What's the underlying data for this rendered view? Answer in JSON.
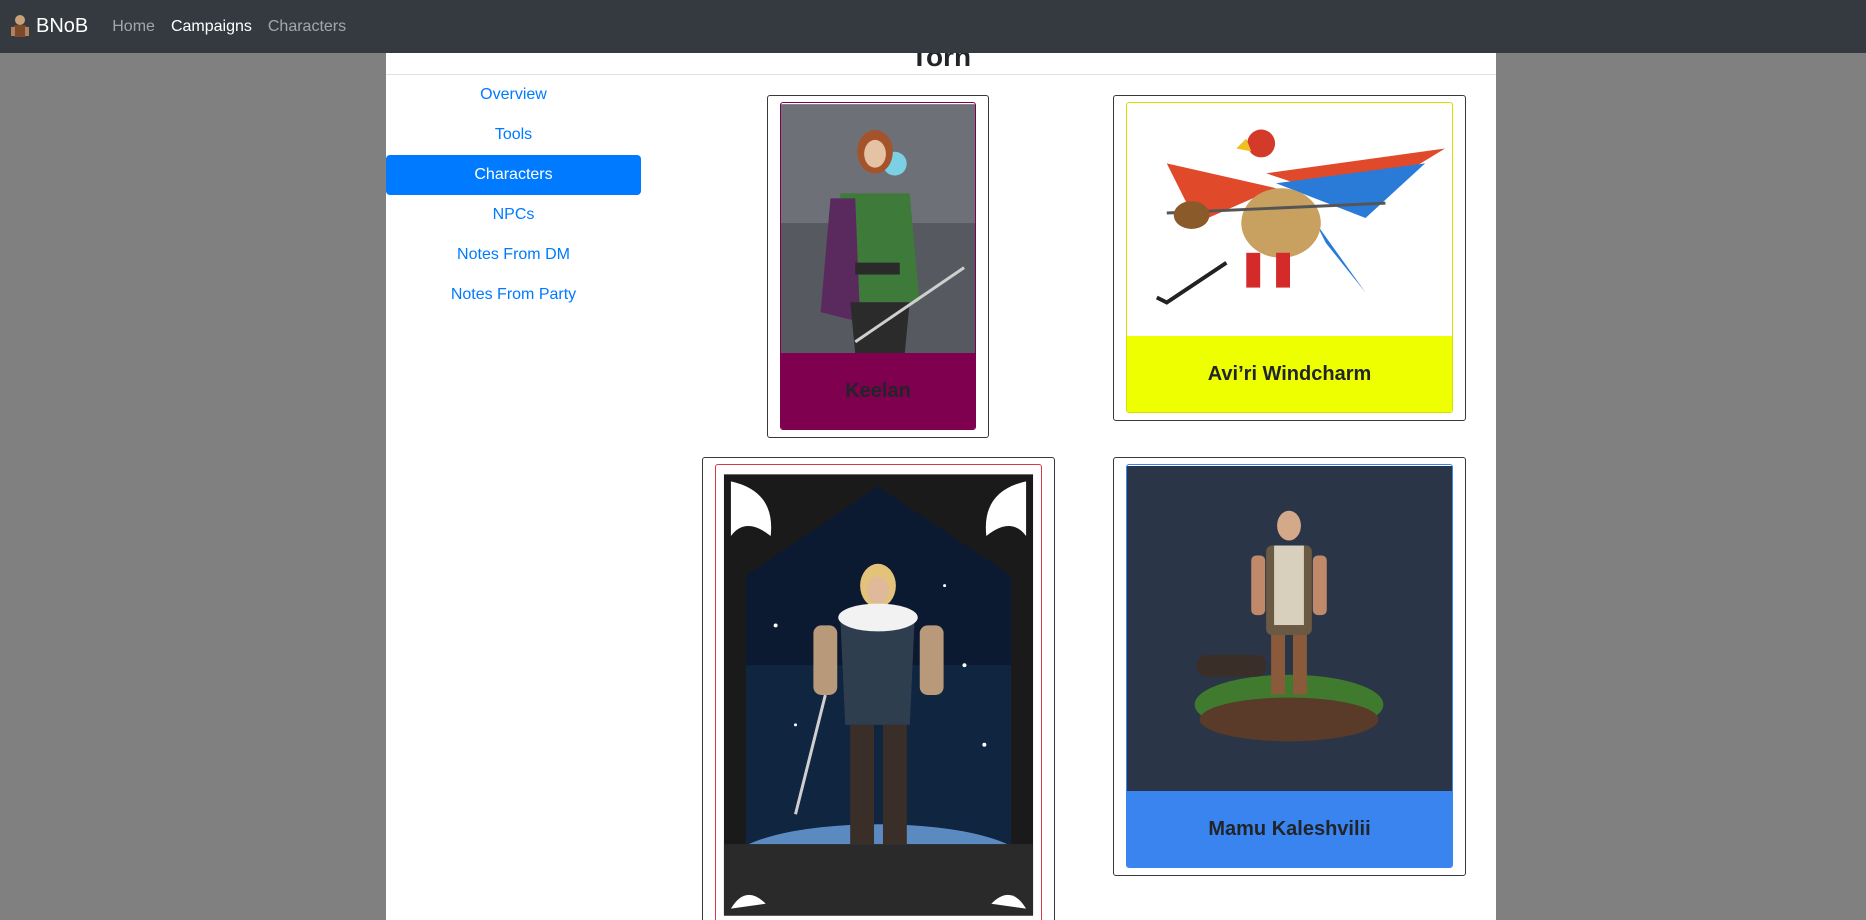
{
  "navbar": {
    "brand": "BNoB",
    "links": [
      "Home",
      "Campaigns",
      "Characters"
    ]
  },
  "page": {
    "title": "Torn"
  },
  "sidebar": {
    "items": [
      {
        "label": "Overview"
      },
      {
        "label": "Tools"
      },
      {
        "label": "Characters"
      },
      {
        "label": "NPCs"
      },
      {
        "label": "Notes From DM"
      },
      {
        "label": "Notes From Party"
      }
    ]
  },
  "characters": [
    {
      "name": "Keelan",
      "color": "#800050"
    },
    {
      "name": "Avi’ri Windcharm",
      "color": "#eeff00"
    },
    {
      "name": "",
      "color": "#dc3545"
    },
    {
      "name": "Mamu Kaleshvilii",
      "color": "#3a84f0"
    }
  ]
}
